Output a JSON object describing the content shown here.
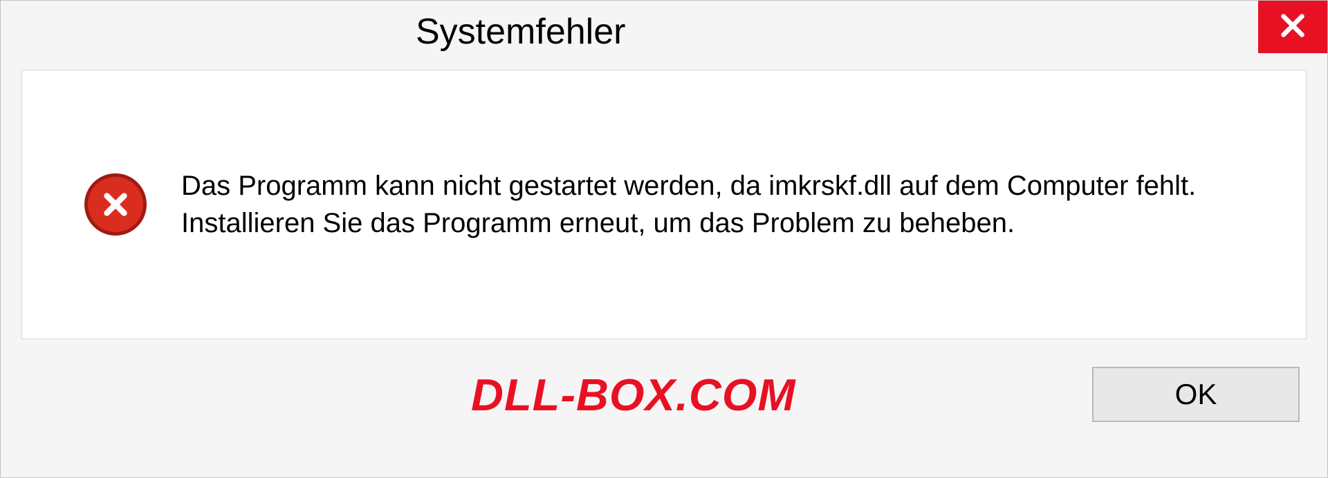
{
  "dialog": {
    "title": "Systemfehler",
    "message": "Das Programm kann nicht gestartet werden, da imkrskf.dll auf dem Computer fehlt. Installieren Sie das Programm erneut, um das Problem zu beheben.",
    "ok_label": "OK"
  },
  "watermark": "DLL-BOX.COM"
}
